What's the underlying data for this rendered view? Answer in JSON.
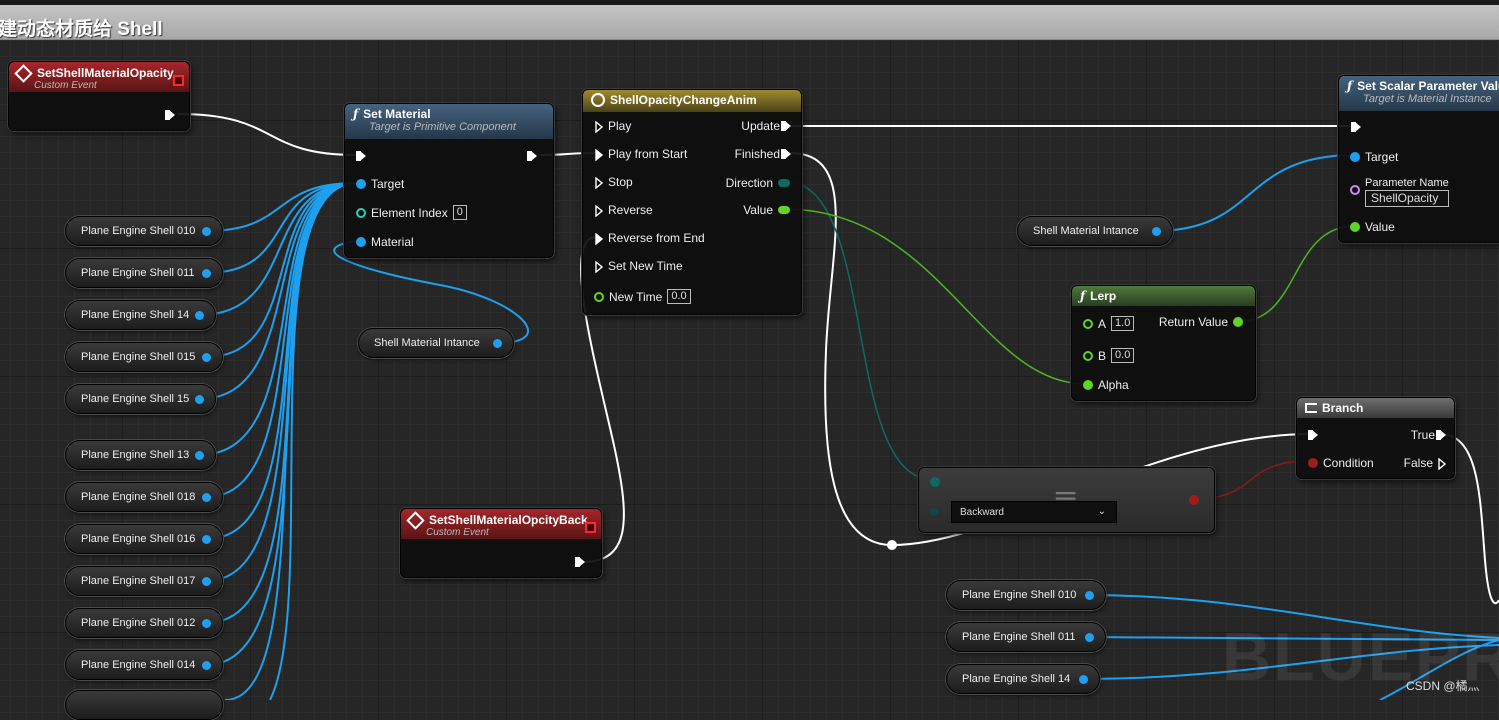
{
  "comment": {
    "title": "建动态材质给 Shell"
  },
  "event_set_opacity": {
    "title": "SetShellMaterialOpacity",
    "subtitle": "Custom Event"
  },
  "event_opacity_back": {
    "title": "SetShellMaterialOpcityBack",
    "subtitle": "Custom Event"
  },
  "set_material": {
    "title": "Set Material",
    "subtitle": "Target is Primitive Component",
    "pins": {
      "target": "Target",
      "element_index": "Element Index",
      "element_index_value": "0",
      "material": "Material"
    }
  },
  "timeline": {
    "title": "ShellOpacityChangeAnim",
    "inputs": [
      "Play",
      "Play from Start",
      "Stop",
      "Reverse",
      "Reverse from End",
      "Set New Time"
    ],
    "new_time_label": "New Time",
    "new_time_value": "0.0",
    "outputs": [
      "Update",
      "Finished",
      "Direction",
      "Value"
    ]
  },
  "set_scalar": {
    "title": "Set Scalar Parameter Value",
    "subtitle": "Target is Material Instance",
    "pins": {
      "target": "Target",
      "param_name": "Parameter Name",
      "param_value": "ShellOpacity",
      "value": "Value"
    }
  },
  "lerp": {
    "title": "Lerp",
    "a_label": "A",
    "a_value": "1.0",
    "b_label": "B",
    "b_value": "0.0",
    "alpha_label": "Alpha",
    "return_label": "Return Value"
  },
  "branch": {
    "title": "Branch",
    "condition": "Condition",
    "true_label": "True",
    "false_label": "False"
  },
  "equal": {
    "symbol": "==",
    "dropdown_value": "Backward"
  },
  "shell_vars_left": [
    "Plane Engine Shell 010",
    "Plane Engine Shell 011",
    "Plane Engine Shell 14",
    "Plane Engine Shell 015",
    "Plane Engine Shell 15",
    "Plane Engine Shell 13",
    "Plane Engine Shell 018",
    "Plane Engine Shell 016",
    "Plane Engine Shell 017",
    "Plane Engine Shell 012",
    "Plane Engine Shell 014"
  ],
  "shell_vars_bottom": [
    "Plane Engine Shell 010",
    "Plane Engine Shell 011",
    "Plane Engine Shell 14"
  ],
  "material_instance_var": "Shell Material Intance",
  "material_instance_var2": "Shell Material Intance",
  "watermark": "BLUEPRINT",
  "credit": "CSDN @橘灬",
  "colors": {
    "exec": "#ffffff",
    "object": "#1ea0f0",
    "float": "#5fd425",
    "bool": "#a11c1c",
    "enum": "#0c6a5e"
  }
}
